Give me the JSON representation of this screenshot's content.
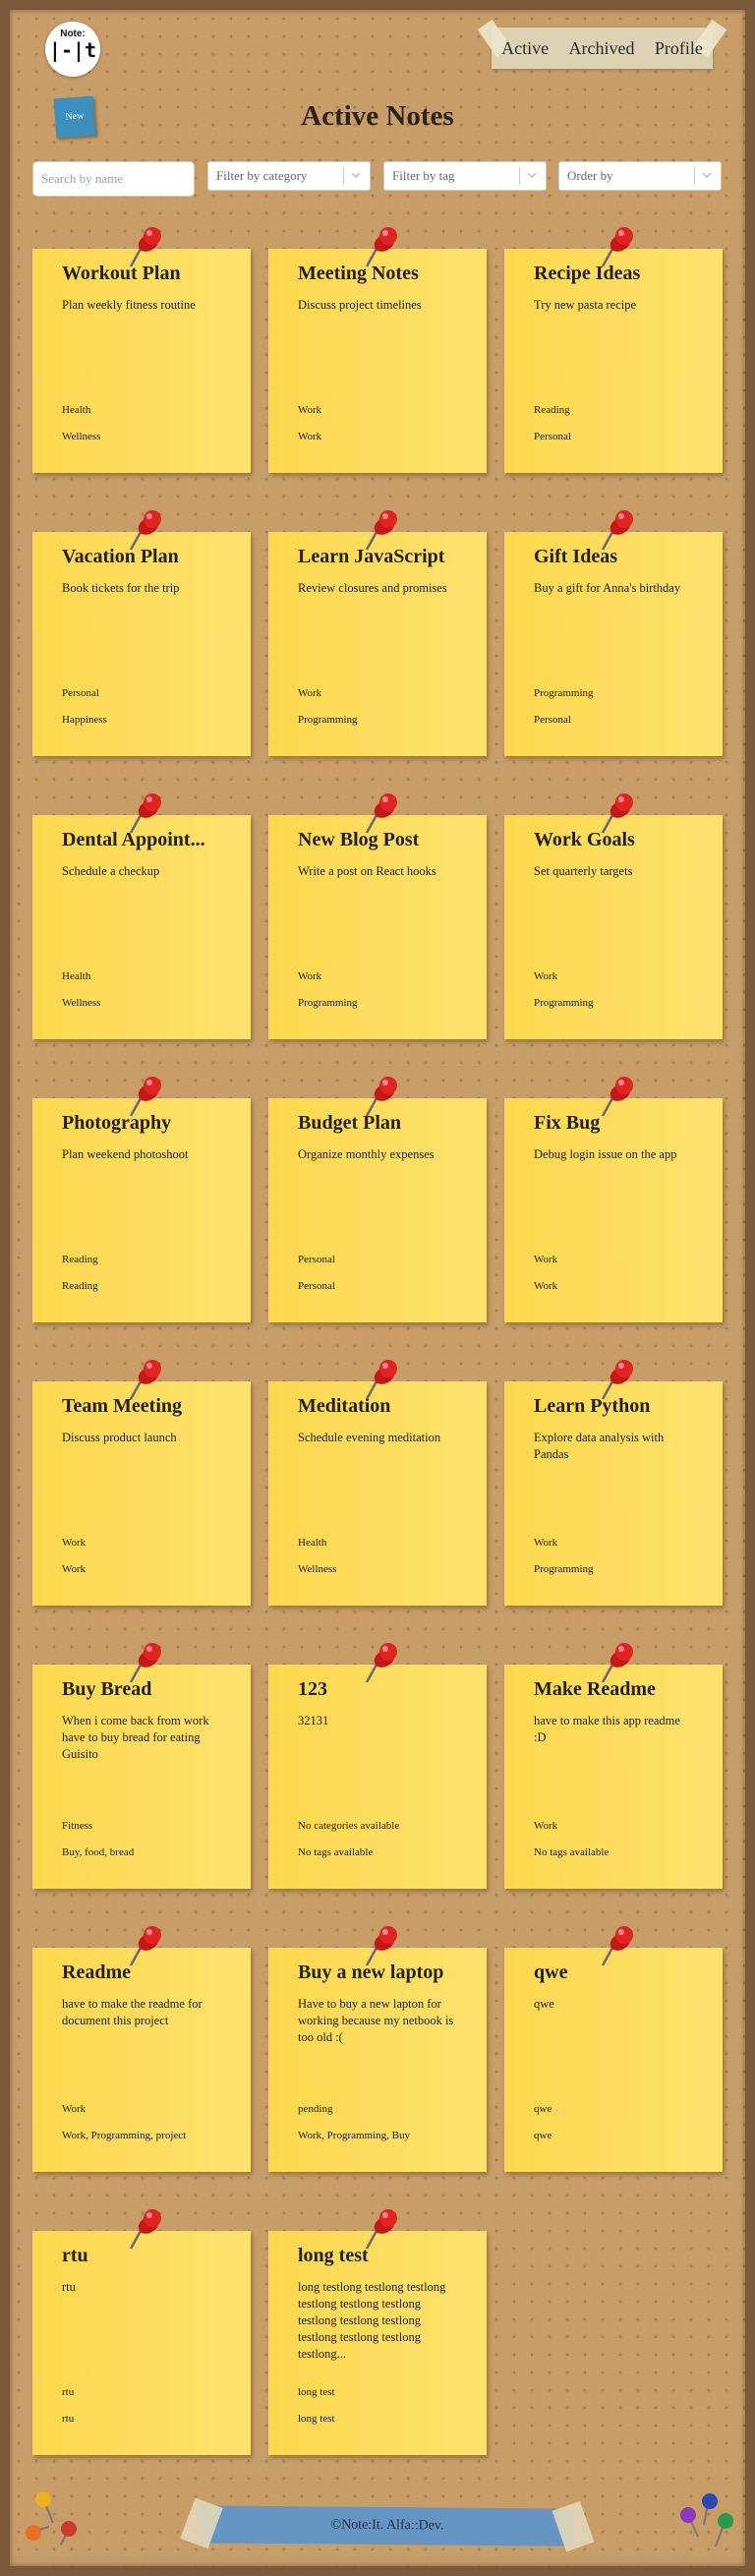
{
  "app": {
    "logo_top": "Note:",
    "logo_main": "|-|t"
  },
  "nav": {
    "items": [
      "Active",
      "Archived",
      "Profile"
    ]
  },
  "toolbar": {
    "new_label": "New"
  },
  "page": {
    "title": "Active Notes"
  },
  "filters": {
    "search_placeholder": "Search by name",
    "category": "Filter by category",
    "tag": "Filter by tag",
    "order": "Order by"
  },
  "colors": {
    "board": "#c89d68",
    "note": "#fdd84e",
    "pin": "#e02020",
    "new_button": "#3d8fbf",
    "footer": "#6595c3"
  },
  "notes": [
    {
      "title": "Workout Plan",
      "desc": "Plan weekly fitness routine",
      "cat": "Health",
      "tag": "Wellness"
    },
    {
      "title": "Meeting Notes",
      "desc": "Discuss project timelines",
      "cat": "Work",
      "tag": "Work"
    },
    {
      "title": "Recipe Ideas",
      "desc": "Try new pasta recipe",
      "cat": "Reading",
      "tag": "Personal"
    },
    {
      "title": "Vacation Plan",
      "desc": "Book tickets for the trip",
      "cat": "Personal",
      "tag": "Happiness"
    },
    {
      "title": "Learn JavaScript",
      "desc": "Review closures and promises",
      "cat": "Work",
      "tag": "Programming"
    },
    {
      "title": "Gift Ideas",
      "desc": "Buy a gift for Anna's birthday",
      "cat": "Programming",
      "tag": "Personal"
    },
    {
      "title": "Dental Appoint...",
      "desc": "Schedule a checkup",
      "cat": "Health",
      "tag": "Wellness"
    },
    {
      "title": "New Blog Post",
      "desc": "Write a post on React hooks",
      "cat": "Work",
      "tag": "Programming"
    },
    {
      "title": "Work Goals",
      "desc": "Set quarterly targets",
      "cat": "Work",
      "tag": "Programming"
    },
    {
      "title": "Photography",
      "desc": "Plan weekend photoshoot",
      "cat": "Reading",
      "tag": "Reading"
    },
    {
      "title": "Budget Plan",
      "desc": "Organize monthly expenses",
      "cat": "Personal",
      "tag": "Personal"
    },
    {
      "title": "Fix Bug",
      "desc": "Debug login issue on the app",
      "cat": "Work",
      "tag": "Work"
    },
    {
      "title": "Team Meeting",
      "desc": "Discuss product launch",
      "cat": "Work",
      "tag": "Work"
    },
    {
      "title": "Meditation",
      "desc": "Schedule evening meditation",
      "cat": "Health",
      "tag": "Wellness"
    },
    {
      "title": "Learn Python",
      "desc": "Explore data analysis with Pandas",
      "cat": "Work",
      "tag": "Programming"
    },
    {
      "title": "Buy Bread",
      "desc": "When i come back from work have to buy bread for eating Guisito",
      "cat": "Fitness",
      "tag": "Buy, food, bread"
    },
    {
      "title": "123",
      "desc": "32131",
      "cat": "No categories available",
      "tag": "No tags available"
    },
    {
      "title": "Make Readme",
      "desc": "have to make this app readme :D",
      "cat": "Work",
      "tag": "No tags available"
    },
    {
      "title": "Readme",
      "desc": "have to make the readme for document this project",
      "cat": "Work",
      "tag": "Work, Programming, project"
    },
    {
      "title": "Buy a new laptop",
      "desc": "Have to buy a new lapton for working because my netbook is too old :(",
      "cat": "pending",
      "tag": "Work, Programming, Buy"
    },
    {
      "title": "qwe",
      "desc": "qwe",
      "cat": "qwe",
      "tag": "qwe"
    },
    {
      "title": "rtu",
      "desc": "rtu",
      "cat": "rtu",
      "tag": "rtu"
    },
    {
      "title": "long test",
      "desc": "long testlong testlong testlong testlong testlong testlong testlong testlong testlong testlong testlong testlong testlong...",
      "cat": "long test",
      "tag": "long test"
    }
  ],
  "footer": {
    "text": "©Note:It. Alfa::Dev."
  }
}
